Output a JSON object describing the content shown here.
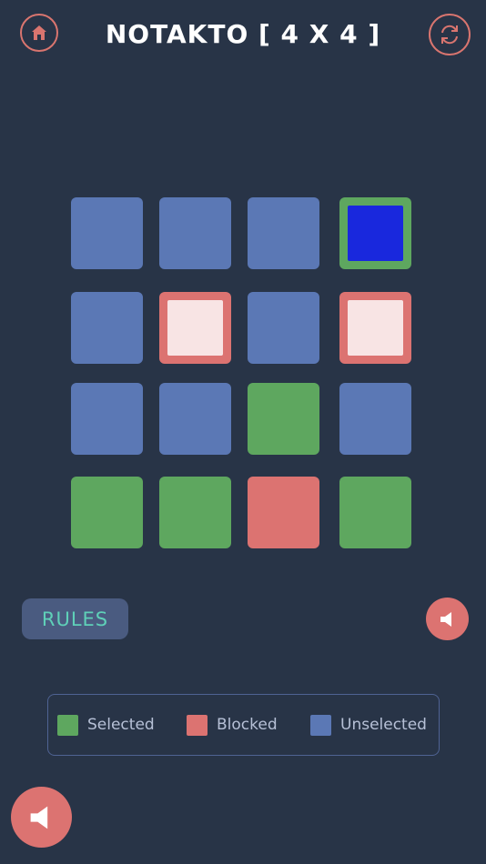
{
  "header": {
    "title": "NOTAKTO [ 4 X 4 ]",
    "home_icon": "home-icon",
    "refresh_icon": "refresh-icon"
  },
  "colors": {
    "background": "#283447",
    "accent": "#d9756f",
    "selected": "#5ea75f",
    "blocked": "#dc7371",
    "unselected": "#5b78b5",
    "active_selected_inner": "#1928dd",
    "active_blocked_inner": "#f8e4e4"
  },
  "board": {
    "size": "4x4",
    "cells": [
      [
        "unselected",
        "unselected",
        "unselected",
        "selected-active"
      ],
      [
        "unselected",
        "blocked-active",
        "unselected",
        "blocked-active"
      ],
      [
        "unselected",
        "unselected",
        "selected",
        "unselected"
      ],
      [
        "selected",
        "selected",
        "blocked",
        "selected"
      ]
    ]
  },
  "controls": {
    "rules_label": "RULES",
    "sound_small_icon": "speaker-icon",
    "sound_large_icon": "speaker-icon"
  },
  "legend": {
    "items": [
      {
        "label": "Selected",
        "color": "#5ea75f"
      },
      {
        "label": "Blocked",
        "color": "#dc7371"
      },
      {
        "label": "Unselected",
        "color": "#5b78b5"
      }
    ]
  }
}
